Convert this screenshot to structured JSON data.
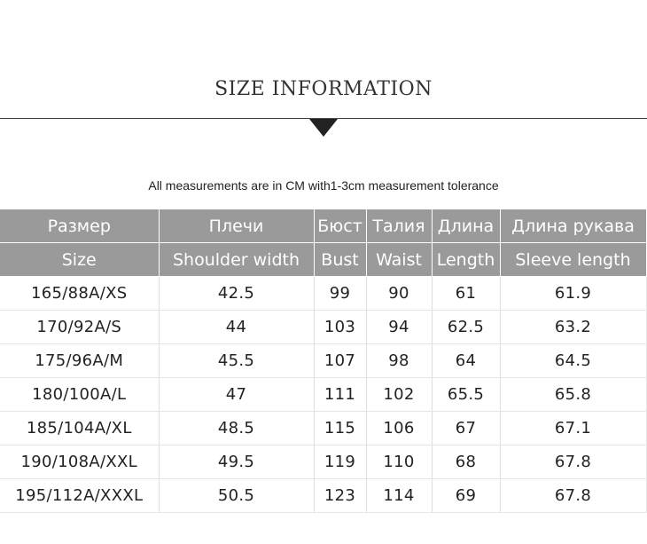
{
  "title": "SIZE INFORMATION",
  "note": "All measurements are in CM with1-3cm measurement tolerance",
  "colors": {
    "header_bg": "#9a9a9a",
    "header_text": "#ffffff",
    "rule": "#444444"
  },
  "icons": {
    "divider_marker": "triangle-down-icon"
  },
  "table": {
    "header_ru": [
      "Размер",
      "Плечи",
      "Бюст",
      "Талия",
      "Длина",
      "Длина рукава"
    ],
    "header_en": [
      "Size",
      "Shoulder width",
      "Bust",
      "Waist",
      "Length",
      "Sleeve length"
    ],
    "rows": [
      [
        "165/88A/XS",
        "42.5",
        "99",
        "90",
        "61",
        "61.9"
      ],
      [
        "170/92A/S",
        "44",
        "103",
        "94",
        "62.5",
        "63.2"
      ],
      [
        "175/96A/M",
        "45.5",
        "107",
        "98",
        "64",
        "64.5"
      ],
      [
        "180/100A/L",
        "47",
        "111",
        "102",
        "65.5",
        "65.8"
      ],
      [
        "185/104A/XL",
        "48.5",
        "115",
        "106",
        "67",
        "67.1"
      ],
      [
        "190/108A/XXL",
        "49.5",
        "119",
        "110",
        "68",
        "67.8"
      ],
      [
        "195/112A/XXXL",
        "50.5",
        "123",
        "114",
        "69",
        "67.8"
      ]
    ]
  }
}
